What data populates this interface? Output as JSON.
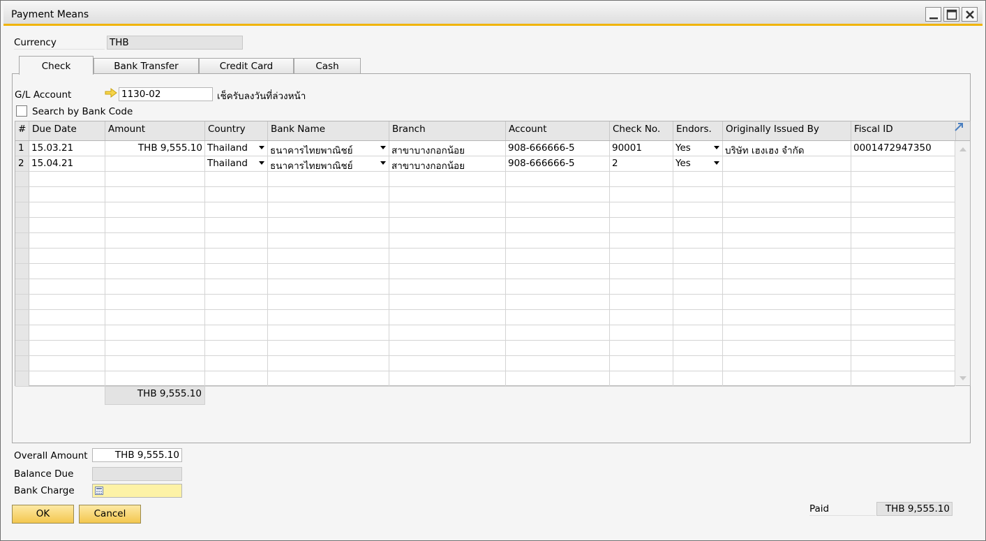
{
  "window": {
    "title": "Payment Means"
  },
  "currency": {
    "label": "Currency",
    "value": "THB"
  },
  "tabs": [
    "Check",
    "Bank Transfer",
    "Credit Card",
    "Cash"
  ],
  "gl": {
    "label": "G/L Account",
    "value": "1130-02",
    "description": "เช็ครับลงวันที่ล่วงหน้า"
  },
  "search_by_bank": {
    "label": "Search by Bank Code",
    "checked": false
  },
  "grid": {
    "columns": [
      "#",
      "Due Date",
      "Amount",
      "Country",
      "Bank Name",
      "Branch",
      "Account",
      "Check No.",
      "Endors.",
      "Originally Issued By",
      "Fiscal ID"
    ],
    "rows": [
      {
        "num": "1",
        "due": "15.03.21",
        "amount": "THB 9,555.10",
        "country": "Thailand",
        "bank": "ธนาคารไทยพาณิชย์",
        "branch": "สาขาบางกอกน้อย",
        "account": "908-666666-5",
        "check": "90001",
        "endors": "Yes",
        "issued": "บริษัท เฮงเฮง จำกัด",
        "fiscal": "0001472947350"
      },
      {
        "num": "2",
        "due": "15.04.21",
        "amount": "",
        "country": "Thailand",
        "bank": "ธนาคารไทยพาณิชย์",
        "branch": "สาขาบางกอกน้อย",
        "account": "908-666666-5",
        "check": "2",
        "endors": "Yes",
        "issued": "",
        "fiscal": ""
      }
    ],
    "total": "THB 9,555.10"
  },
  "overall_amount": {
    "label": "Overall Amount",
    "value": "THB 9,555.10"
  },
  "balance_due": {
    "label": "Balance Due",
    "value": ""
  },
  "bank_charge": {
    "label": "Bank Charge",
    "value": ""
  },
  "paid": {
    "label": "Paid",
    "value": "THB 9,555.10"
  },
  "buttons": {
    "ok": "OK",
    "cancel": "Cancel"
  }
}
